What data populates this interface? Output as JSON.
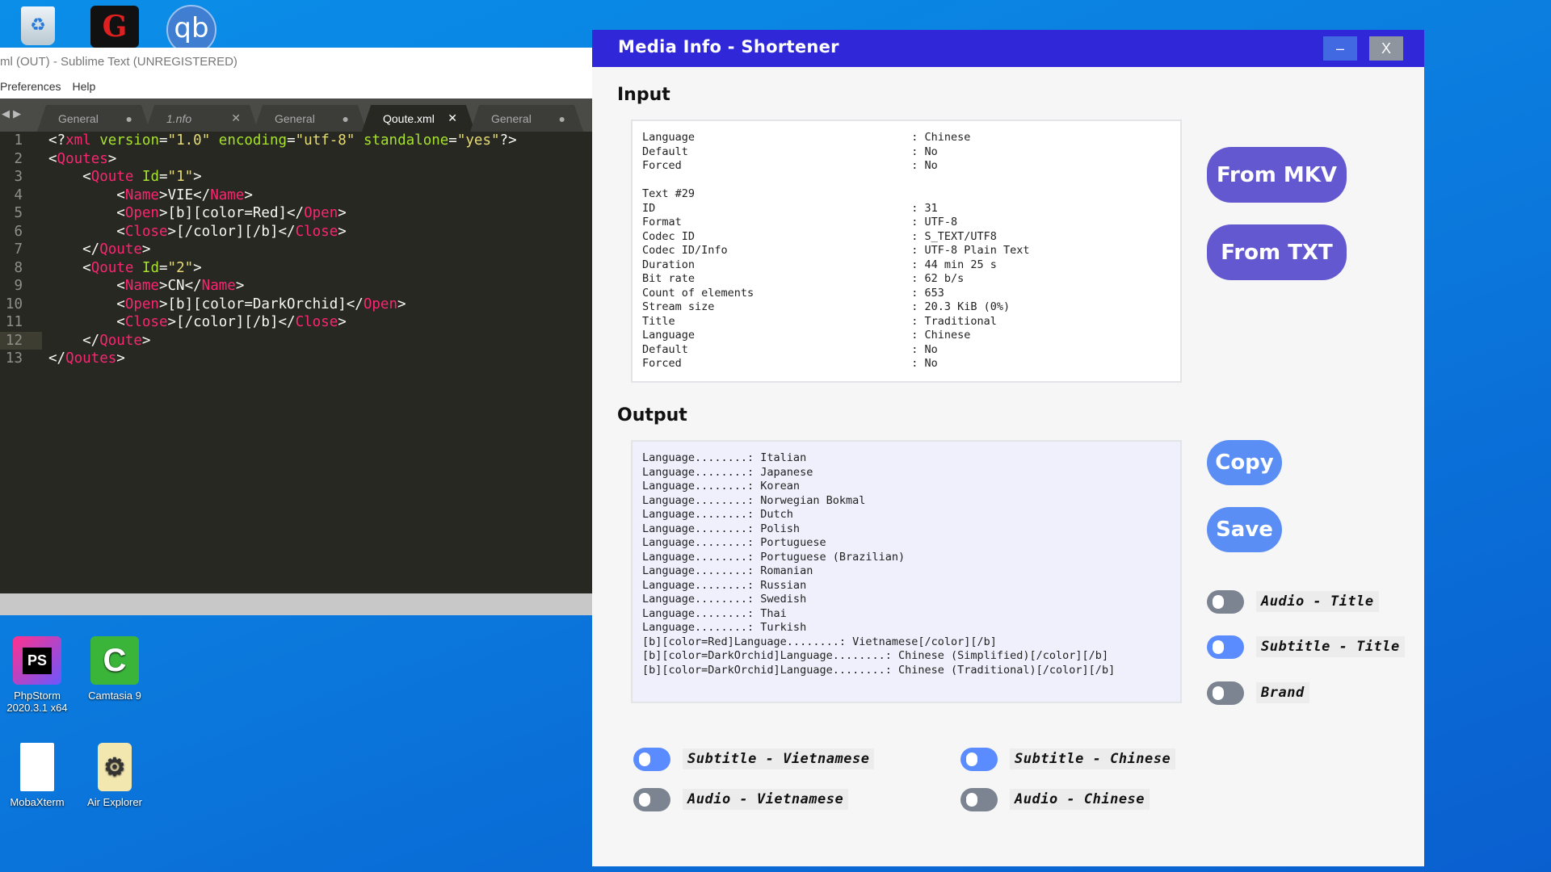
{
  "desktop": {
    "top_icons": [
      "recycle-bin",
      "garena",
      "qbittorrent"
    ],
    "top_icon_text": {
      "qb": "qb"
    },
    "icons": [
      {
        "label": "PhpStorm 2020.3.1 x64",
        "glyph": "PS"
      },
      {
        "label": "Camtasia 9",
        "glyph": "C"
      },
      {
        "label": "MobaXterm",
        "glyph": ""
      },
      {
        "label": "Air Explorer",
        "glyph": "⚙"
      }
    ]
  },
  "sublime": {
    "title": "ml (OUT) - Sublime Text (UNREGISTERED)",
    "menu": [
      "Preferences",
      "Help"
    ],
    "tabs": [
      {
        "label": "General",
        "mark": "●"
      },
      {
        "label": "1.nfo",
        "mark": "✕"
      },
      {
        "label": "General",
        "mark": "●"
      },
      {
        "label": "Qoute.xml",
        "mark": "✕",
        "active": true
      },
      {
        "label": "General",
        "mark": "●"
      }
    ],
    "current_line": 12,
    "lines": [
      [
        [
          "p",
          "<?"
        ],
        [
          "t",
          "xml"
        ],
        [
          "p",
          " "
        ],
        [
          "a",
          "version"
        ],
        [
          "p",
          "="
        ],
        [
          "s",
          "\"1.0\""
        ],
        [
          "p",
          " "
        ],
        [
          "a",
          "encoding"
        ],
        [
          "p",
          "="
        ],
        [
          "s",
          "\"utf-8\""
        ],
        [
          "p",
          " "
        ],
        [
          "a",
          "standalone"
        ],
        [
          "p",
          "="
        ],
        [
          "s",
          "\"yes\""
        ],
        [
          "p",
          "?>"
        ]
      ],
      [
        [
          "p",
          "<"
        ],
        [
          "t",
          "Qoutes"
        ],
        [
          "p",
          ">"
        ]
      ],
      [
        [
          "p",
          "    <"
        ],
        [
          "t",
          "Qoute"
        ],
        [
          "p",
          " "
        ],
        [
          "a",
          "Id"
        ],
        [
          "p",
          "="
        ],
        [
          "s",
          "\"1\""
        ],
        [
          "p",
          ">"
        ]
      ],
      [
        [
          "p",
          "        <"
        ],
        [
          "t",
          "Name"
        ],
        [
          "p",
          ">VIE</"
        ],
        [
          "t",
          "Name"
        ],
        [
          "p",
          ">"
        ]
      ],
      [
        [
          "p",
          "        <"
        ],
        [
          "t",
          "Open"
        ],
        [
          "p",
          ">[b][color=Red]</"
        ],
        [
          "t",
          "Open"
        ],
        [
          "p",
          ">"
        ]
      ],
      [
        [
          "p",
          "        <"
        ],
        [
          "t",
          "Close"
        ],
        [
          "p",
          ">[/color][/b]</"
        ],
        [
          "t",
          "Close"
        ],
        [
          "p",
          ">"
        ]
      ],
      [
        [
          "p",
          "    </"
        ],
        [
          "t",
          "Qoute"
        ],
        [
          "p",
          ">"
        ]
      ],
      [
        [
          "p",
          "    <"
        ],
        [
          "t",
          "Qoute"
        ],
        [
          "p",
          " "
        ],
        [
          "a",
          "Id"
        ],
        [
          "p",
          "="
        ],
        [
          "s",
          "\"2\""
        ],
        [
          "p",
          ">"
        ]
      ],
      [
        [
          "p",
          "        <"
        ],
        [
          "t",
          "Name"
        ],
        [
          "p",
          ">CN</"
        ],
        [
          "t",
          "Name"
        ],
        [
          "p",
          ">"
        ]
      ],
      [
        [
          "p",
          "        <"
        ],
        [
          "t",
          "Open"
        ],
        [
          "p",
          ">[b][color=DarkOrchid]</"
        ],
        [
          "t",
          "Open"
        ],
        [
          "p",
          ">"
        ]
      ],
      [
        [
          "p",
          "        <"
        ],
        [
          "t",
          "Close"
        ],
        [
          "p",
          ">[/color][/b]</"
        ],
        [
          "t",
          "Close"
        ],
        [
          "p",
          ">"
        ]
      ],
      [
        [
          "p",
          "    </"
        ],
        [
          "t",
          "Qoute"
        ],
        [
          "p",
          ">"
        ]
      ],
      [
        [
          "p",
          "</"
        ],
        [
          "t",
          "Qoutes"
        ],
        [
          "p",
          ">"
        ]
      ]
    ]
  },
  "app": {
    "title": "Media Info - Shortener",
    "minimize": "–",
    "close": "X",
    "input_heading": "Input",
    "input_text": "Language                                 : Chinese\nDefault                                  : No\nForced                                   : No\n\nText #29\nID                                       : 31\nFormat                                   : UTF-8\nCodec ID                                 : S_TEXT/UTF8\nCodec ID/Info                            : UTF-8 Plain Text\nDuration                                 : 44 min 25 s\nBit rate                                 : 62 b/s\nCount of elements                        : 653\nStream size                              : 20.3 KiB (0%)\nTitle                                    : Traditional\nLanguage                                 : Chinese\nDefault                                  : No\nForced                                   : No",
    "output_heading": "Output",
    "output_text": "Language........: Italian\nLanguage........: Japanese\nLanguage........: Korean\nLanguage........: Norwegian Bokmal\nLanguage........: Dutch\nLanguage........: Polish\nLanguage........: Portuguese\nLanguage........: Portuguese (Brazilian)\nLanguage........: Romanian\nLanguage........: Russian\nLanguage........: Swedish\nLanguage........: Thai\nLanguage........: Turkish\n[b][color=Red]Language........: Vietnamese[/color][/b]\n[b][color=DarkOrchid]Language........: Chinese (Simplified)[/color][/b]\n[b][color=DarkOrchid]Language........: Chinese (Traditional)[/color][/b]",
    "buttons": {
      "from_mkv": "From MKV",
      "from_txt": "From TXT",
      "copy": "Copy",
      "save": "Save"
    },
    "toggles": [
      {
        "label": "Audio - Title",
        "on": false
      },
      {
        "label": "Subtitle - Title",
        "on": true
      },
      {
        "label": "Brand",
        "on": false
      },
      {
        "label": "Subtitle - Vietnamese",
        "on": true
      },
      {
        "label": "Subtitle - Chinese",
        "on": true
      },
      {
        "label": "Audio - Vietnamese",
        "on": false
      },
      {
        "label": "Audio - Chinese",
        "on": false
      }
    ],
    "colors": {
      "titlebar": "#3028d8",
      "primary_button": "#6458d0",
      "secondary_button": "#5b8ef5",
      "toggle_on": "#5b8cff",
      "toggle_off": "#7b8490"
    }
  }
}
